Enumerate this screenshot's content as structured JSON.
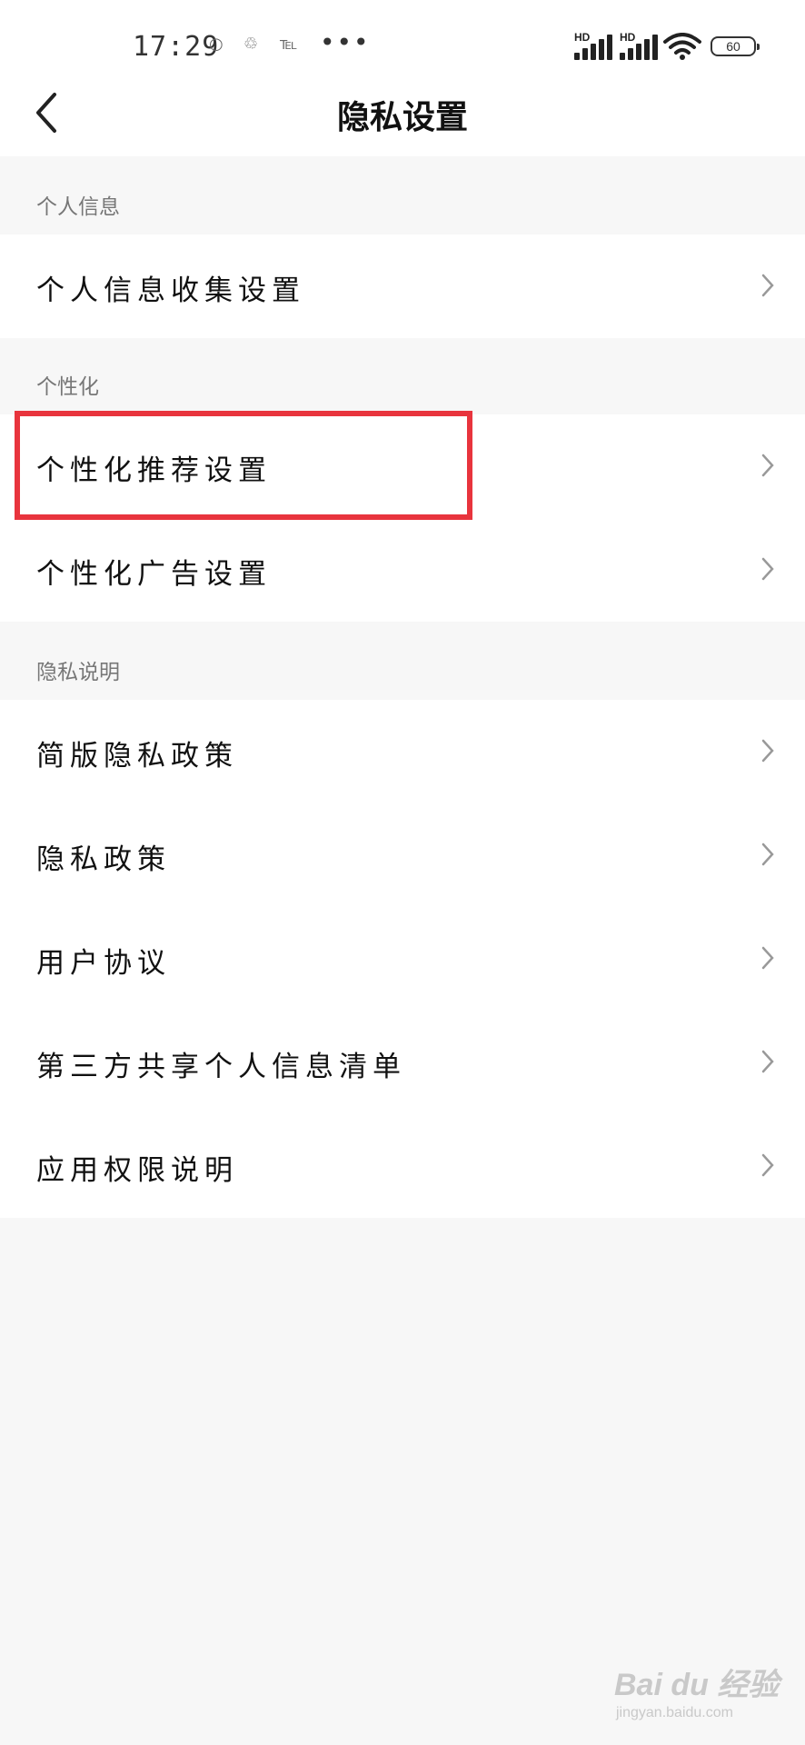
{
  "status_bar": {
    "time": "17:29",
    "small_icons": [
      "○",
      "♲",
      "℡"
    ],
    "more": "•••",
    "signal1_badge": "HD",
    "signal2_badge": "HD",
    "battery": "60"
  },
  "header": {
    "title": "隐私设置"
  },
  "sections": {
    "personal_info": {
      "label": "个人信息",
      "items": [
        "个人信息收集设置"
      ]
    },
    "personalization": {
      "label": "个性化",
      "items": [
        "个性化推荐设置",
        "个性化广告设置"
      ]
    },
    "privacy_notes": {
      "label": "隐私说明",
      "items": [
        "简版隐私政策",
        "隐私政策",
        "用户协议",
        "第三方共享个人信息清单",
        "应用权限说明"
      ]
    }
  },
  "highlight_color": "#e8343d",
  "watermark": {
    "brand": "Bai du 经验",
    "url": "jingyan.baidu.com"
  }
}
